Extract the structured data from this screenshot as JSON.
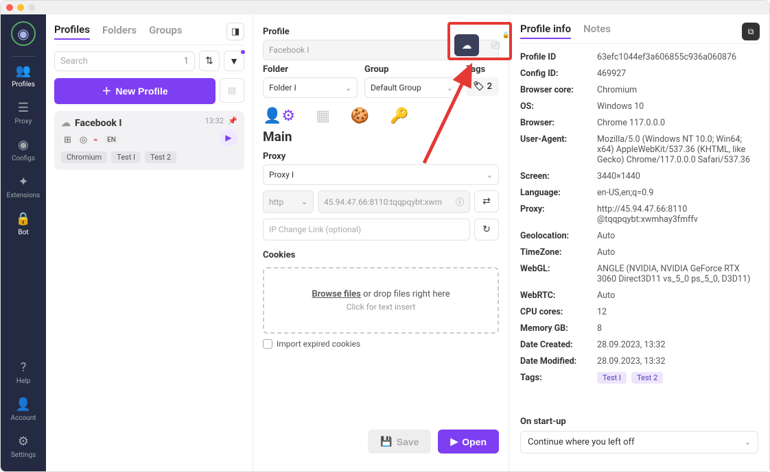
{
  "sidebar": {
    "items": [
      {
        "label": "Profiles"
      },
      {
        "label": "Proxy"
      },
      {
        "label": "Configs"
      },
      {
        "label": "Extensions"
      },
      {
        "label": "Bot"
      }
    ],
    "bottom": [
      {
        "label": "Help"
      },
      {
        "label": "Account"
      },
      {
        "label": "Settings"
      }
    ]
  },
  "leftPanel": {
    "tabs": [
      "Profiles",
      "Folders",
      "Groups"
    ],
    "searchPlaceholder": "Search",
    "searchCount": "1",
    "newProfileLabel": "New Profile",
    "profile": {
      "name": "Facebook I",
      "time": "13:32",
      "enBadge": "EN",
      "chips": [
        "Chromium",
        "Test I",
        "Test 2"
      ]
    }
  },
  "editor": {
    "profileLabel": "Profile",
    "profileValue": "Facebook I",
    "folderLabel": "Folder",
    "folderValue": "Folder I",
    "groupLabel": "Group",
    "groupValue": "Default Group",
    "tagsLabel": "Tags",
    "tagsCount": "2",
    "mainHeading": "Main",
    "proxyLabel": "Proxy",
    "proxyValue": "Proxy I",
    "protocol": "http",
    "proxyDetail": "45.94.47.66:8110:tqqpqybt:xwm",
    "ipChangePlaceholder": "IP Change Link (optional)",
    "cookiesLabel": "Cookies",
    "browseFiles": "Browse files",
    "dropText": " or drop files right here",
    "clickInsert": "Click for text insert",
    "importExpired": "Import expired cookies",
    "saveLabel": "Save",
    "openLabel": "Open"
  },
  "info": {
    "tabs": [
      "Profile info",
      "Notes"
    ],
    "rows": [
      {
        "k": "Profile ID",
        "v": "63efc1044ef3a606855c936a060876"
      },
      {
        "k": "Config ID:",
        "v": "469927"
      },
      {
        "k": "Browser core:",
        "v": "Chromium"
      },
      {
        "k": "OS:",
        "v": "Windows 10"
      },
      {
        "k": "Browser:",
        "v": "Chrome 117.0.0.0"
      },
      {
        "k": "User-Agent:",
        "v": "Mozilla/5.0 (Windows NT 10.0; Win64; x64) AppleWebKit/537.36 (KHTML, like Gecko) Chrome/117.0.0.0 Safari/537.36"
      },
      {
        "k": "Screen:",
        "v": "3440×1440"
      },
      {
        "k": "Language:",
        "v": "en-US,en;q=0.9"
      },
      {
        "k": "Proxy:",
        "v": "http://45.94.47.66:8110 @tqqpqybt:xwmhay3fmffv"
      },
      {
        "k": "Geolocation:",
        "v": "Auto"
      },
      {
        "k": "TimeZone:",
        "v": "Auto"
      },
      {
        "k": "WebGL:",
        "v": "ANGLE (NVIDIA, NVIDIA GeForce RTX 3060 Direct3D11 vs_5_0 ps_5_0, D3D11)"
      },
      {
        "k": "WebRTC:",
        "v": "Auto"
      },
      {
        "k": "CPU cores:",
        "v": "12"
      },
      {
        "k": "Memory GB:",
        "v": "8"
      },
      {
        "k": "Date Created:",
        "v": "28.09.2023, 13:32"
      },
      {
        "k": "Date Modified:",
        "v": "28.09.2023, 13:32"
      }
    ],
    "tagsLabel": "Tags:",
    "tags": [
      "Test I",
      "Test 2"
    ],
    "startupLabel": "On start-up",
    "startupValue": "Continue where you left off"
  }
}
